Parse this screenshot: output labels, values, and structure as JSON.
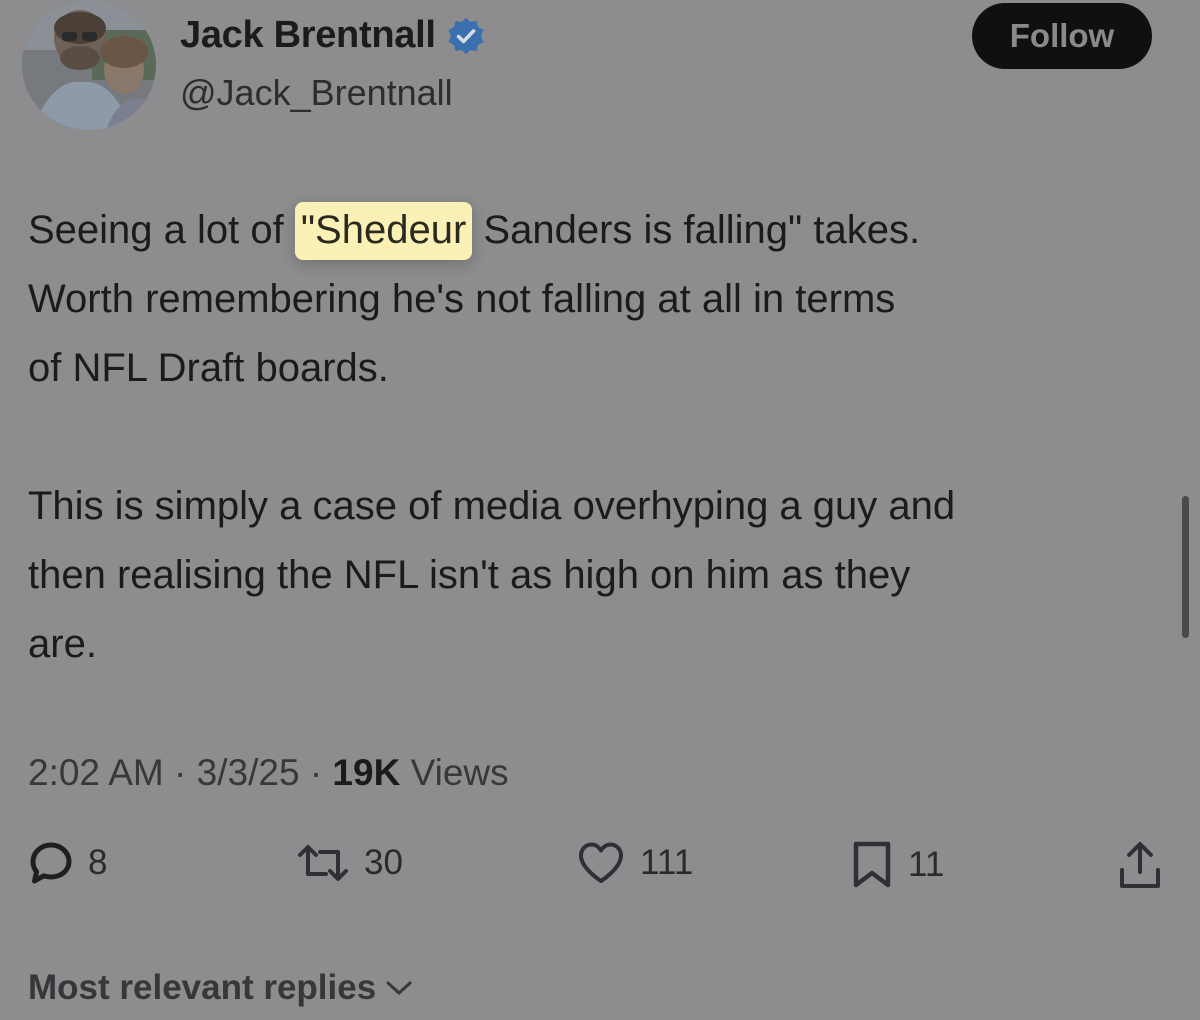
{
  "author": {
    "display_name": "Jack Brentnall",
    "handle": "@Jack_Brentnall",
    "verified": true
  },
  "header": {
    "follow_label": "Follow"
  },
  "tweet": {
    "line1_pre": "Seeing a lot of ",
    "highlight": "\"Shedeur",
    "line1_post": " Sanders is falling\" takes.",
    "line2": "Worth remembering he's not falling at all in terms",
    "line3": "of NFL Draft boards.",
    "line4": "This is simply a case of media overhyping a guy and",
    "line5": "then realising the NFL isn't as high on him as they",
    "line6": "are."
  },
  "meta": {
    "time": "2:02 AM",
    "separator1": " · ",
    "date": "3/3/25",
    "separator2": " · ",
    "views_count": "19K",
    "views_label": " Views"
  },
  "actions": {
    "replies": "8",
    "reposts": "30",
    "likes": "111",
    "bookmarks": "11"
  },
  "replies_sort": {
    "label": "Most relevant replies"
  },
  "colors": {
    "background": "#8d8d8f",
    "verified": "#3a6fb0",
    "highlight": "#fbf1b6",
    "follow_bg": "#101012"
  }
}
